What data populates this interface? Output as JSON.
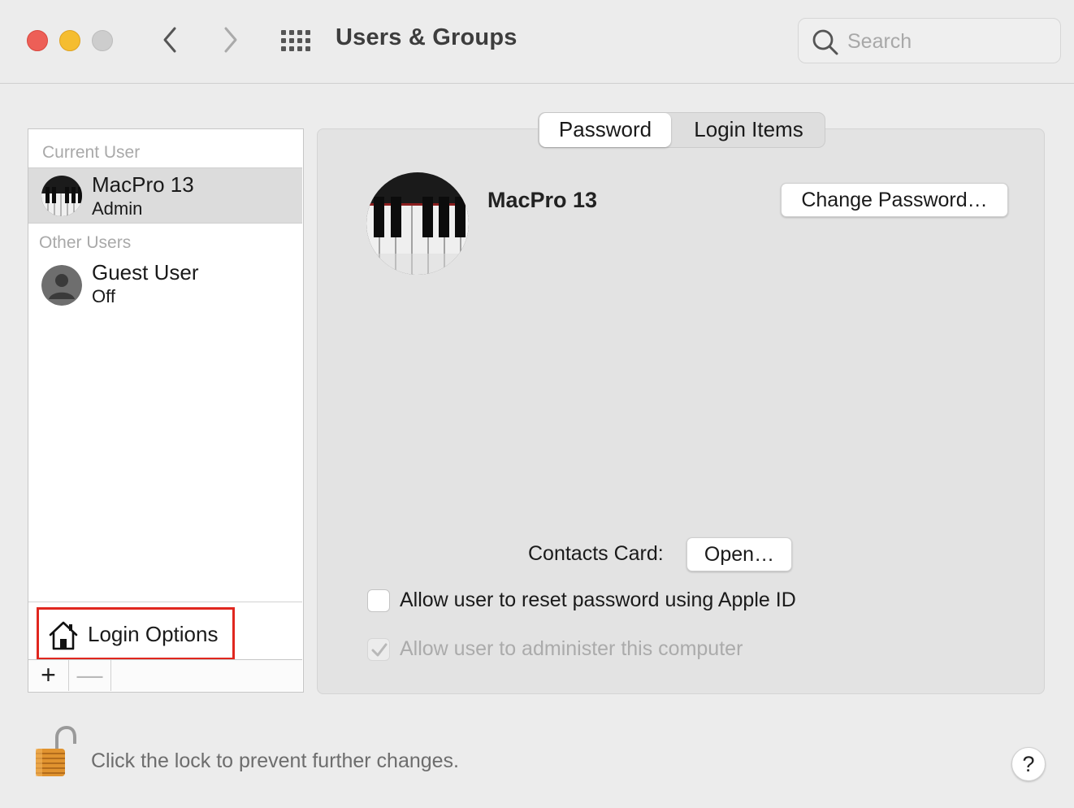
{
  "window": {
    "title": "Users & Groups",
    "traffic_lights": [
      "close",
      "minimize",
      "zoom"
    ]
  },
  "toolbar": {
    "back_icon": "chevron-left-icon",
    "forward_icon": "chevron-right-icon",
    "grid_icon": "show-all-grid-icon",
    "search": {
      "placeholder": "Search",
      "value": ""
    }
  },
  "sidebar": {
    "current_user_header": "Current User",
    "current_user": {
      "name": "MacPro 13",
      "role": "Admin",
      "selected": true
    },
    "other_users_header": "Other Users",
    "other_users": [
      {
        "name": "Guest User",
        "status": "Off"
      }
    ],
    "login_options_label": "Login Options",
    "add_label": "+",
    "remove_label": "—"
  },
  "tabs": [
    {
      "label": "Password",
      "active": true
    },
    {
      "label": "Login Items",
      "active": false
    }
  ],
  "main": {
    "user_name": "MacPro 13",
    "change_password_label": "Change Password…",
    "contacts_card_label": "Contacts Card:",
    "open_label": "Open…",
    "reset_password_label": "Allow user to reset password using Apple ID",
    "reset_password_checked": false,
    "administer_label": "Allow user to administer this computer",
    "administer_checked": true,
    "administer_enabled": false
  },
  "footer": {
    "lock_text": "Click the lock to prevent further changes.",
    "help_label": "?"
  },
  "colors": {
    "close": "#ed5f57",
    "minimize": "#f5bd30",
    "zoom": "#cdcdcd",
    "highlight_box": "#e0271f"
  }
}
